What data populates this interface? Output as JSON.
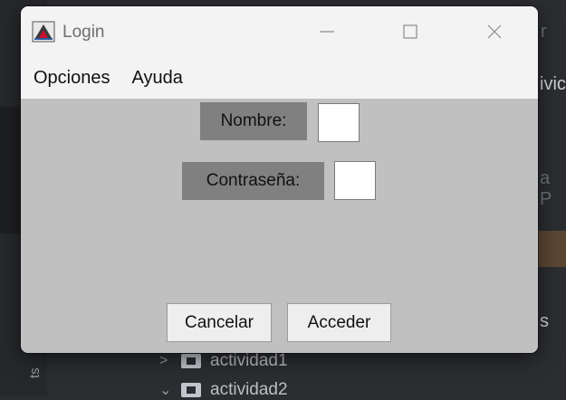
{
  "window": {
    "title": "Login",
    "menu": [
      "Opciones",
      "Ayuda"
    ]
  },
  "form": {
    "nombre_label": "Nombre:",
    "nombre_value": "",
    "password_label": "Contraseña:",
    "password_value": ""
  },
  "buttons": {
    "cancel": "Cancelar",
    "accept": "Acceder"
  },
  "background": {
    "tree_items": [
      {
        "chevron": ">",
        "label": "actividad1"
      },
      {
        "chevron": "⌄",
        "label": "actividad2"
      }
    ],
    "sidebar_text": "ts",
    "right_fragments": [
      "r",
      "ivic",
      "a P",
      "s"
    ]
  },
  "colors": {
    "dialog_bg": "#c0c0c0",
    "label_bg": "#808080",
    "titlebar_bg": "#f3f3f3",
    "ide_bg": "#2b2d30"
  }
}
